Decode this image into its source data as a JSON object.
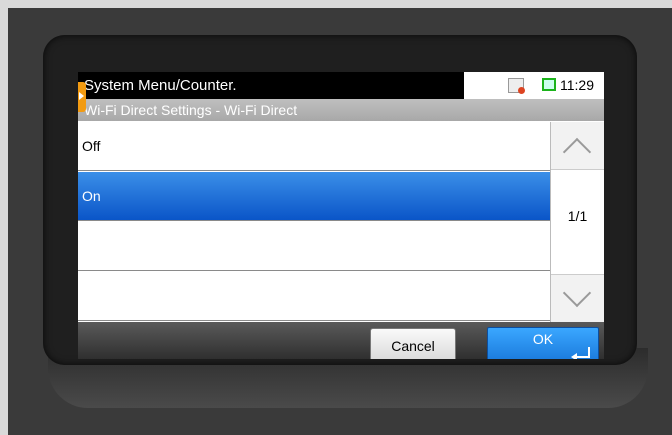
{
  "status_bar": {
    "title": "System Menu/Counter.",
    "time": "11:29",
    "icons": [
      "wifi-disconnected-icon",
      "screen-icon"
    ]
  },
  "subtitle": "Wi-Fi Direct Settings - Wi-Fi Direct",
  "options": [
    {
      "label": "Off",
      "selected": false
    },
    {
      "label": "On",
      "selected": true
    },
    {
      "label": "",
      "selected": false
    },
    {
      "label": "",
      "selected": false
    }
  ],
  "pagination": {
    "indicator": "1/1"
  },
  "footer": {
    "cancel_label": "Cancel",
    "ok_label": "OK"
  },
  "colors": {
    "selected": "#0a55c8",
    "ok_button": "#1876d9",
    "accent_tab": "#f29b12"
  }
}
